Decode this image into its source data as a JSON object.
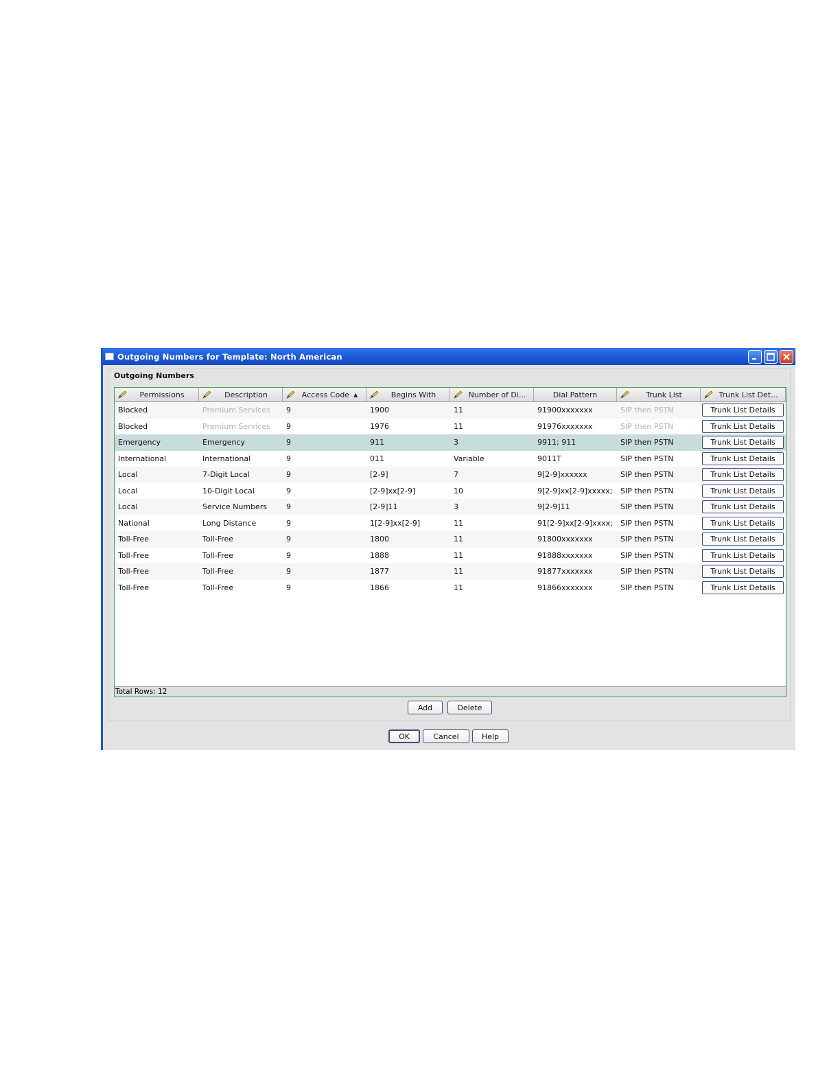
{
  "window": {
    "title": "Outgoing Numbers for Template: North American"
  },
  "panel": {
    "title": "Outgoing Numbers"
  },
  "table": {
    "columns": [
      {
        "label": "Permissions",
        "editable": true
      },
      {
        "label": "Description",
        "editable": true
      },
      {
        "label": "Access Code",
        "editable": true,
        "sort": "ascending"
      },
      {
        "label": "Begins With",
        "editable": true
      },
      {
        "label": "Number of Di...",
        "editable": true
      },
      {
        "label": "Dial Pattern",
        "editable": false
      },
      {
        "label": "Trunk List",
        "editable": true
      },
      {
        "label": "Trunk List Det...",
        "editable": true
      }
    ],
    "rows": [
      {
        "permissions": "Blocked",
        "description": "Premium Services",
        "access_code": "9",
        "begins_with": "1900",
        "digits": "11",
        "dial_pattern": "91900xxxxxxx",
        "trunk_list": "SIP then PSTN",
        "details": "Trunk List Details",
        "dim": true
      },
      {
        "permissions": "Blocked",
        "description": "Premium Services",
        "access_code": "9",
        "begins_with": "1976",
        "digits": "11",
        "dial_pattern": "91976xxxxxxx",
        "trunk_list": "SIP then PSTN",
        "details": "Trunk List Details",
        "dim": true
      },
      {
        "permissions": "Emergency",
        "description": "Emergency",
        "access_code": "9",
        "begins_with": "911",
        "digits": "3",
        "dial_pattern": "9911; 911",
        "trunk_list": "SIP then PSTN",
        "details": "Trunk List Details",
        "selected": true
      },
      {
        "permissions": "International",
        "description": "International",
        "access_code": "9",
        "begins_with": "011",
        "digits": "Variable",
        "dial_pattern": "9011T",
        "trunk_list": "SIP then PSTN",
        "details": "Trunk List Details"
      },
      {
        "permissions": "Local",
        "description": "7-Digit Local",
        "access_code": "9",
        "begins_with": "[2-9]",
        "digits": "7",
        "dial_pattern": "9[2-9]xxxxxx",
        "trunk_list": "SIP then PSTN",
        "details": "Trunk List Details"
      },
      {
        "permissions": "Local",
        "description": "10-Digit Local",
        "access_code": "9",
        "begins_with": "[2-9]xx[2-9]",
        "digits": "10",
        "dial_pattern": "9[2-9]xx[2-9]xxxxx;",
        "trunk_list": "SIP then PSTN",
        "details": "Trunk List Details"
      },
      {
        "permissions": "Local",
        "description": "Service Numbers",
        "access_code": "9",
        "begins_with": "[2-9]11",
        "digits": "3",
        "dial_pattern": "9[2-9]11",
        "trunk_list": "SIP then PSTN",
        "details": "Trunk List Details"
      },
      {
        "permissions": "National",
        "description": "Long Distance",
        "access_code": "9",
        "begins_with": "1[2-9]xx[2-9]",
        "digits": "11",
        "dial_pattern": "91[2-9]xx[2-9]xxxx;",
        "trunk_list": "SIP then PSTN",
        "details": "Trunk List Details"
      },
      {
        "permissions": "Toll-Free",
        "description": "Toll-Free",
        "access_code": "9",
        "begins_with": "1800",
        "digits": "11",
        "dial_pattern": "91800xxxxxxx",
        "trunk_list": "SIP then PSTN",
        "details": "Trunk List Details"
      },
      {
        "permissions": "Toll-Free",
        "description": "Toll-Free",
        "access_code": "9",
        "begins_with": "1888",
        "digits": "11",
        "dial_pattern": "91888xxxxxxx",
        "trunk_list": "SIP then PSTN",
        "details": "Trunk List Details"
      },
      {
        "permissions": "Toll-Free",
        "description": "Toll-Free",
        "access_code": "9",
        "begins_with": "1877",
        "digits": "11",
        "dial_pattern": "91877xxxxxxx",
        "trunk_list": "SIP then PSTN",
        "details": "Trunk List Details"
      },
      {
        "permissions": "Toll-Free",
        "description": "Toll-Free",
        "access_code": "9",
        "begins_with": "1866",
        "digits": "11",
        "dial_pattern": "91866xxxxxxx",
        "trunk_list": "SIP then PSTN",
        "details": "Trunk List Details"
      }
    ],
    "footer": "Total Rows: 12"
  },
  "buttons": {
    "add": "Add",
    "delete": "Delete",
    "ok": "OK",
    "cancel": "Cancel",
    "help": "Help"
  },
  "icons": {
    "edit": "pencil-icon",
    "sort": "sort-ascending-icon",
    "minimize": "minimize-icon",
    "maximize": "maximize-icon",
    "close": "close-icon"
  },
  "colors": {
    "titlebar": "#1a56d6",
    "grid_border": "#3f9a4e",
    "selected_row": "#c8dcdc",
    "dim_text": "#b3b3b3"
  }
}
